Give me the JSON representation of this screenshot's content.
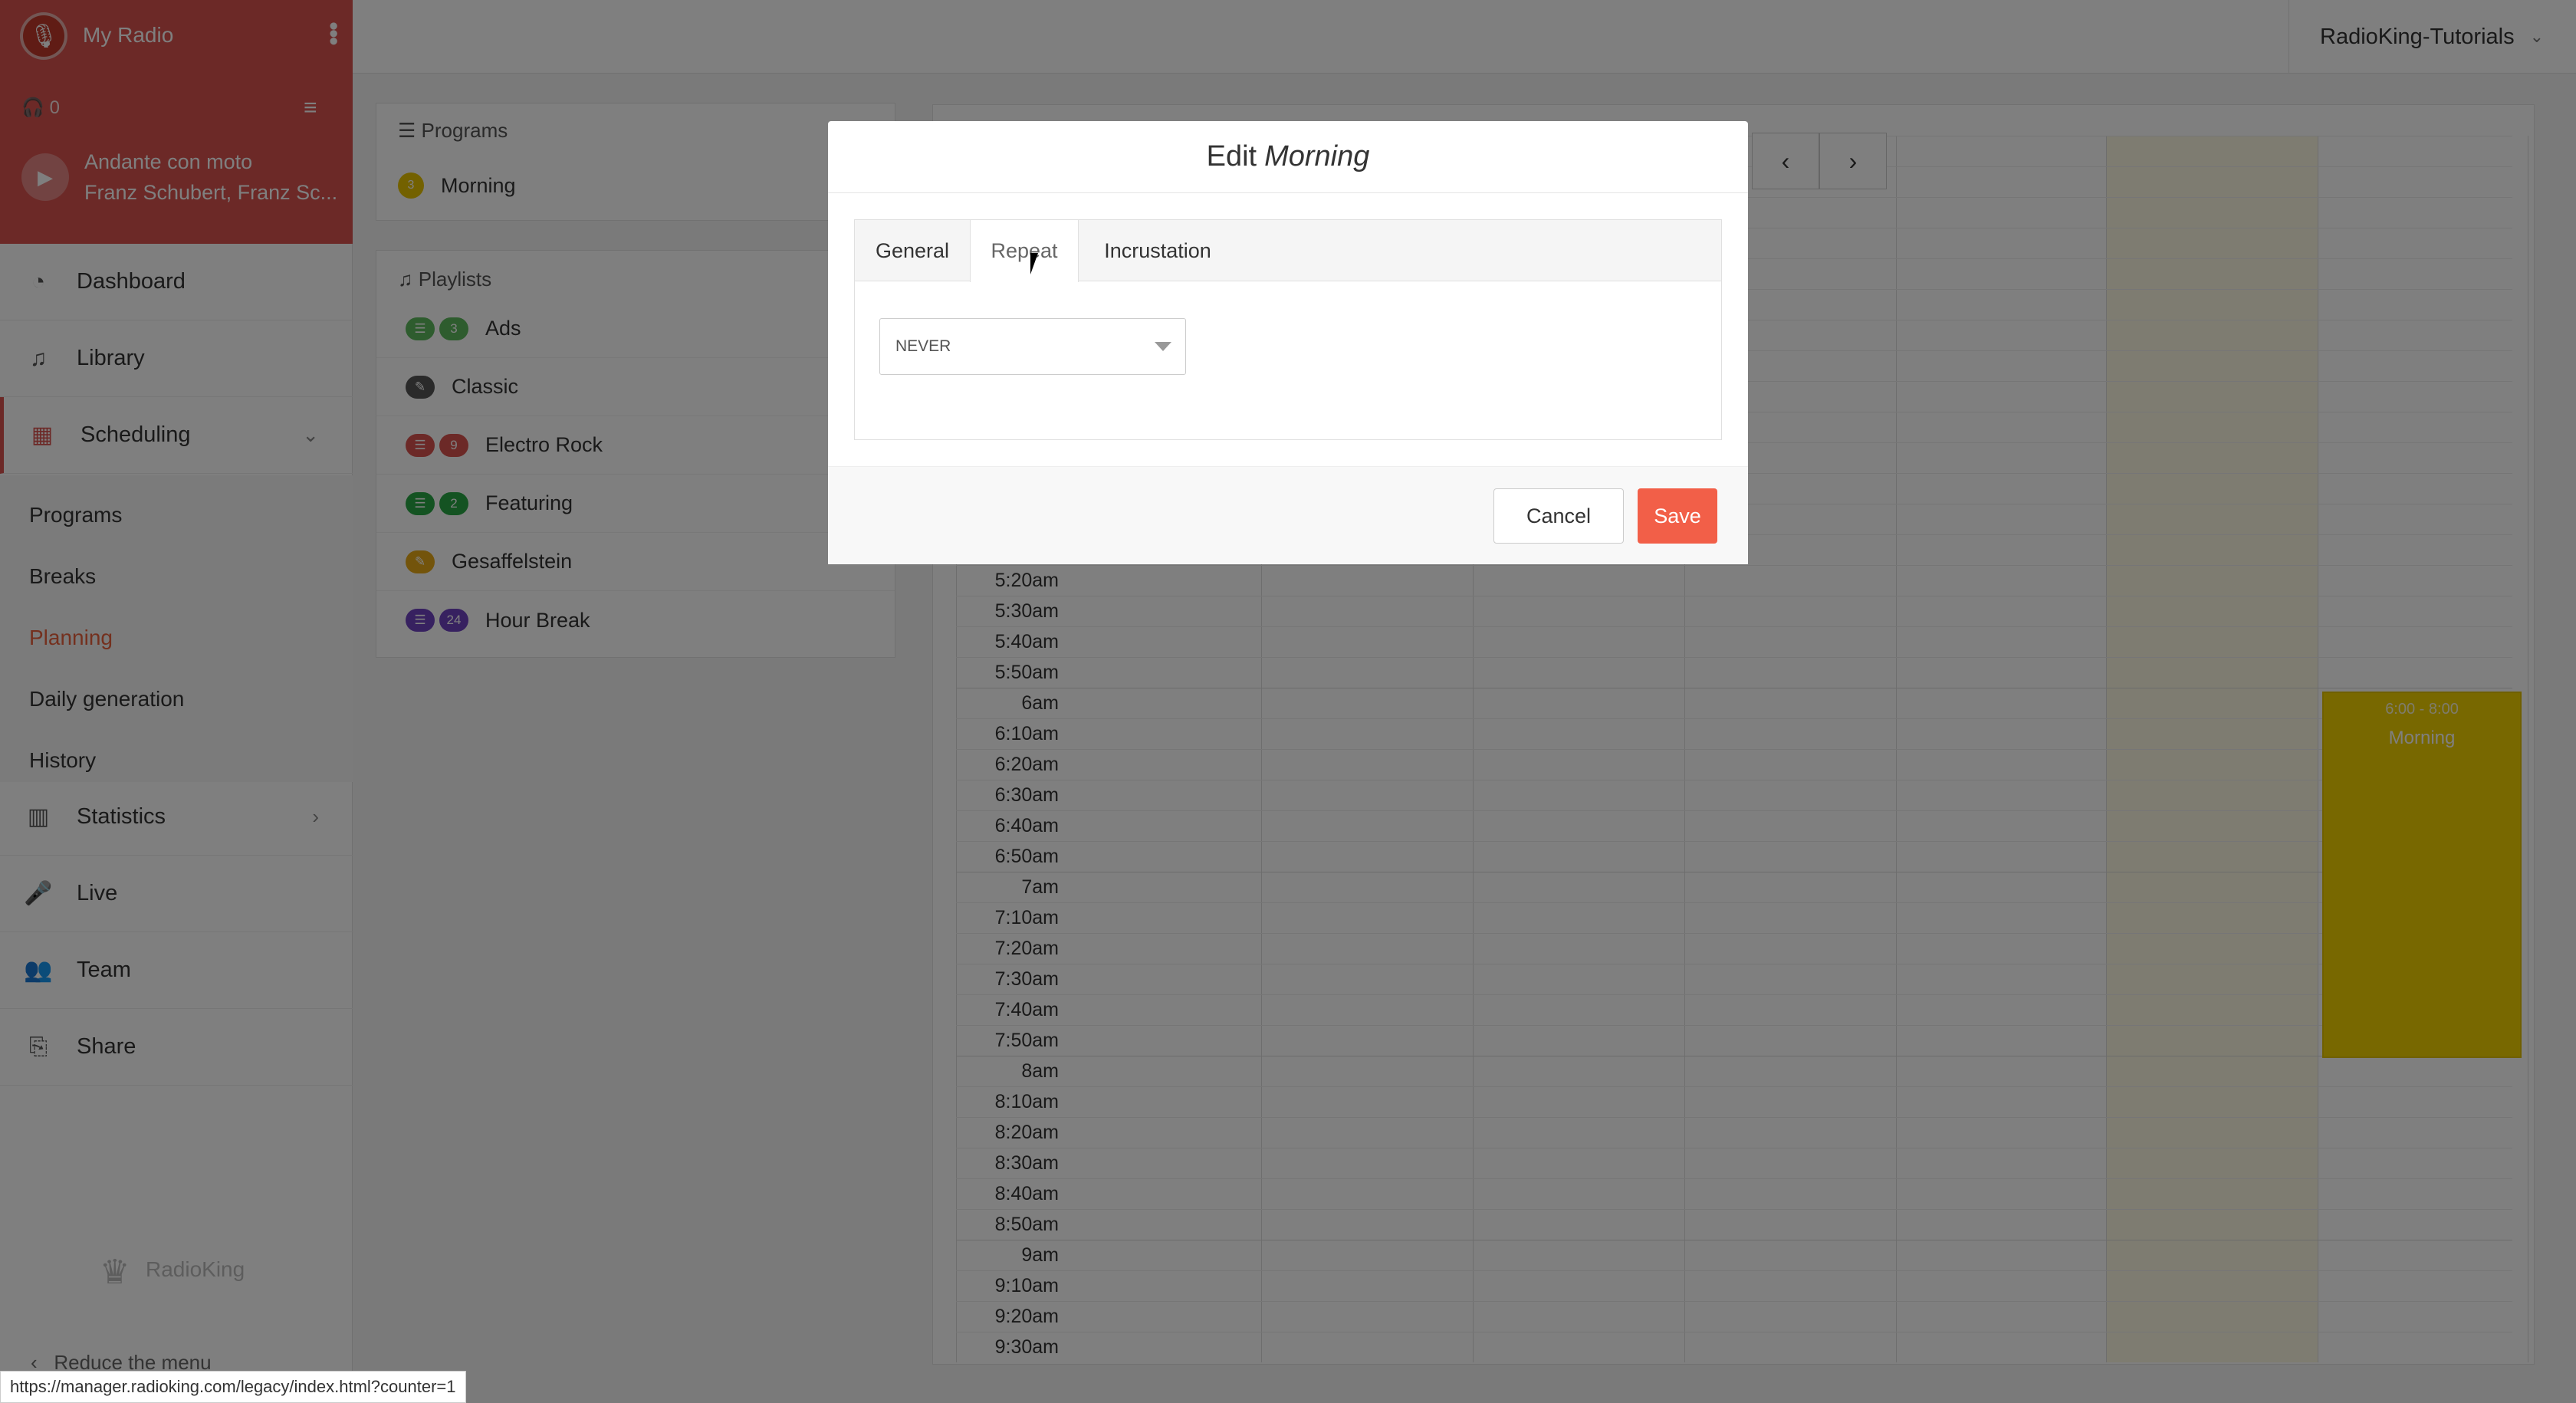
{
  "radio": {
    "name": "My Radio",
    "listeners": "0",
    "track_title": "Andante con moto",
    "track_artist": "Franz Schubert, Franz Sc..."
  },
  "nav": {
    "dashboard": "Dashboard",
    "library": "Library",
    "scheduling": "Scheduling",
    "statistics": "Statistics",
    "live": "Live",
    "team": "Team",
    "share": "Share",
    "sub": {
      "programs": "Programs",
      "breaks": "Breaks",
      "planning": "Planning",
      "daily_generation": "Daily generation",
      "history": "History"
    },
    "brand": "RadioKing",
    "reduce": "Reduce the menu"
  },
  "account": {
    "name": "RadioKing-Tutorials"
  },
  "programs_panel": {
    "title": "Programs",
    "items": [
      {
        "count": "3",
        "name": "Morning"
      }
    ]
  },
  "playlists_panel": {
    "title": "Playlists",
    "items": [
      {
        "badge": "3",
        "name": "Ads",
        "color": "#5cb85c"
      },
      {
        "badge": "",
        "name": "Classic",
        "color": "#555555"
      },
      {
        "badge": "9",
        "name": "Electro Rock",
        "color": "#d9534f"
      },
      {
        "badge": "2",
        "name": "Featuring",
        "color": "#28a745"
      },
      {
        "badge": "",
        "name": "Gesaffelstein",
        "color": "#e6a817"
      },
      {
        "badge": "24",
        "name": "Hour Break",
        "color": "#6f42c1"
      }
    ]
  },
  "calendar": {
    "times": [
      "5:20am",
      "5:30am",
      "5:40am",
      "5:50am",
      "6am",
      "6:10am",
      "6:20am",
      "6:30am",
      "6:40am",
      "6:50am",
      "7am",
      "7:10am",
      "7:20am",
      "7:30am",
      "7:40am",
      "7:50am",
      "8am",
      "8:10am",
      "8:20am",
      "8:30am",
      "8:40am",
      "8:50am",
      "9am",
      "9:10am",
      "9:20am",
      "9:30am"
    ],
    "event": {
      "time": "6:00 - 8:00",
      "name": "Morning",
      "color": "#f0d000"
    }
  },
  "modal": {
    "title_prefix": "Edit",
    "title_name": "Morning",
    "tabs": {
      "general": "General",
      "repeat": "Repeat",
      "incrustation": "Incrustation"
    },
    "repeat_value": "NEVER",
    "cancel": "Cancel",
    "save": "Save",
    "save_color": "#f25f48"
  },
  "status_url": "https://manager.radioking.com/legacy/index.html?counter=1"
}
